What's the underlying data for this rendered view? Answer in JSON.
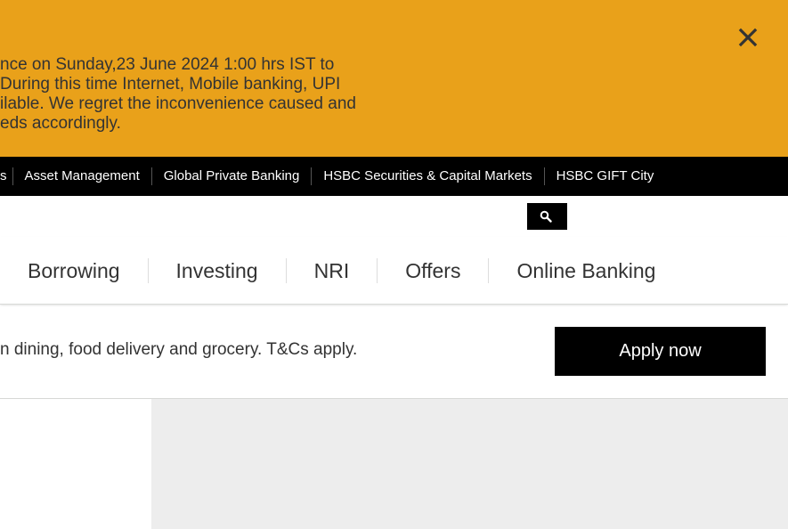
{
  "notice": {
    "lines": [
      "nce on Sunday,23 June 2024 1:00 hrs IST to",
      " During this time Internet, Mobile banking, UPI",
      "ilable. We regret the inconvenience caused and",
      "eds accordingly."
    ],
    "close_icon": "close-icon"
  },
  "topnav": {
    "items": [
      "s",
      "Asset Management",
      "Global Private Banking",
      "HSBC Securities & Capital Markets",
      "HSBC GIFT City"
    ]
  },
  "search": {
    "icon": "search-icon"
  },
  "mainnav": {
    "items": [
      "Borrowing",
      "Investing",
      "NRI",
      "Offers",
      "Online Banking"
    ]
  },
  "promo": {
    "text": "n dining, food delivery and grocery. T&Cs apply.",
    "button_label": "Apply now"
  },
  "colors": {
    "notice_bg": "#e9a11a",
    "topnav_bg": "#000000",
    "content_bg": "#ededed"
  }
}
